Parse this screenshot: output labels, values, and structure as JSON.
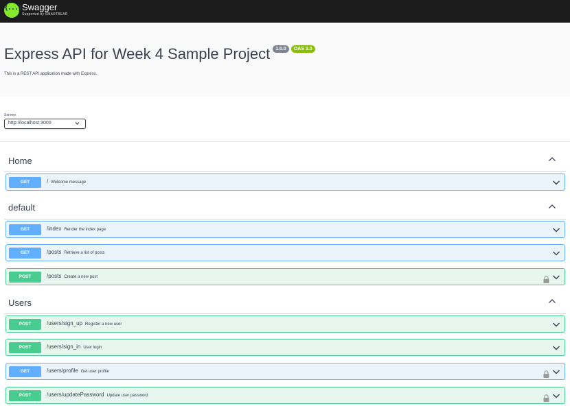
{
  "topbar": {
    "logo_glyph": "{...}",
    "logo_title": "Swagger",
    "logo_subtitle": "Supported by SMARTBEAR",
    "background": "#1b1b1b",
    "logo_color": "#85ea2d"
  },
  "info": {
    "title": "Express API for Week 4 Sample Project",
    "version_badge": "1.0.0",
    "oas_badge": "OAS 3.0",
    "description": "This is a REST API application made with Express."
  },
  "servers": {
    "label": "Servers",
    "selected": "http://localhost:3000",
    "chevron_icon": "chevron-down-icon"
  },
  "sections": [
    {
      "name": "Home",
      "collapse_icon": "chevron-up-icon",
      "operations": [
        {
          "method": "GET",
          "path": "/",
          "summary": "Welcome message",
          "locked": false
        }
      ]
    },
    {
      "name": "default",
      "collapse_icon": "chevron-up-icon",
      "operations": [
        {
          "method": "GET",
          "path": "/index",
          "summary": "Render the index page",
          "locked": false
        },
        {
          "method": "GET",
          "path": "/posts",
          "summary": "Retrieve a list of posts",
          "locked": false
        },
        {
          "method": "POST",
          "path": "/posts",
          "summary": "Create a new post",
          "locked": true
        }
      ]
    },
    {
      "name": "Users",
      "collapse_icon": "chevron-up-icon",
      "operations": [
        {
          "method": "POST",
          "path": "/users/sign_up",
          "summary": "Register a new user",
          "locked": false
        },
        {
          "method": "POST",
          "path": "/users/sign_in",
          "summary": "User login",
          "locked": false
        },
        {
          "method": "GET",
          "path": "/users/profile",
          "summary": "Get user profile",
          "locked": true
        },
        {
          "method": "POST",
          "path": "/users/updatePassword",
          "summary": "Update user password",
          "locked": true
        }
      ]
    }
  ],
  "colors": {
    "get_accent": "#61affe",
    "get_background": "#ebf3fb",
    "post_accent": "#49cc90",
    "post_background": "#e8f6f0",
    "version_badge": "#7d8492",
    "oas_badge": "#89bf04"
  }
}
